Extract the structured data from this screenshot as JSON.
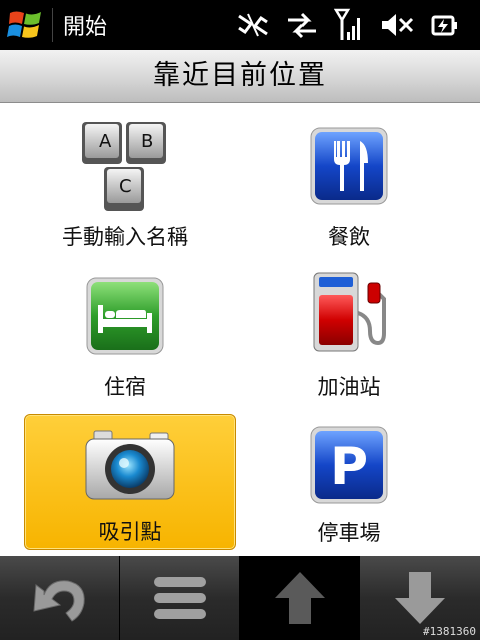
{
  "statusbar": {
    "start_label": "開始",
    "icons": [
      "network-disconnected-icon",
      "data-transfer-icon",
      "signal-strength-icon",
      "volume-muted-icon",
      "battery-charging-icon"
    ]
  },
  "page": {
    "title": "靠近目前位置"
  },
  "grid": {
    "items": [
      {
        "label": "手動輸入名稱",
        "icon": "abc-keys-icon",
        "selected": false
      },
      {
        "label": "餐飲",
        "icon": "fork-knife-icon",
        "selected": false
      },
      {
        "label": "住宿",
        "icon": "bed-icon",
        "selected": false
      },
      {
        "label": "加油站",
        "icon": "fuel-pump-icon",
        "selected": false
      },
      {
        "label": "吸引點",
        "icon": "camera-icon",
        "selected": true
      },
      {
        "label": "停車場",
        "icon": "parking-icon",
        "selected": false
      }
    ],
    "abc_keys": [
      "A",
      "B",
      "C"
    ],
    "parking_letter": "P"
  },
  "toolbar": {
    "buttons": [
      "back-icon",
      "menu-icon",
      "scroll-up-icon",
      "scroll-down-icon"
    ],
    "active_index": 2
  },
  "watermark": "#1381360",
  "colors": {
    "selected": "#f7b400",
    "status_bg": "#000000"
  }
}
